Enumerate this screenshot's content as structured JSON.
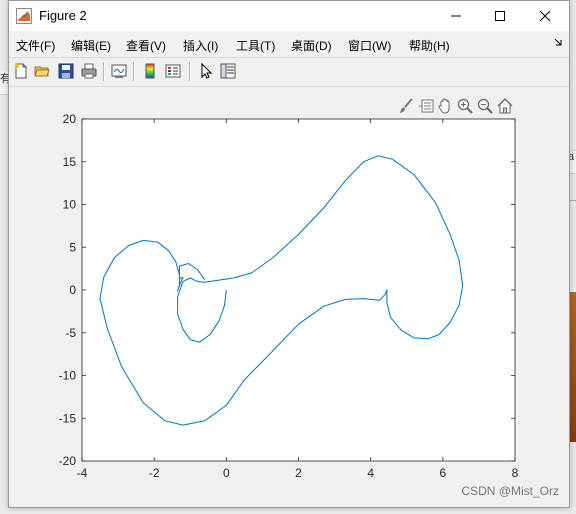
{
  "window": {
    "title": "Figure 2",
    "buttons": {
      "minimize": "—",
      "maximize": "☐",
      "close": "✕"
    }
  },
  "menu": {
    "items": [
      {
        "label": "文件(F)"
      },
      {
        "label": "编辑(E)"
      },
      {
        "label": "查看(V)"
      },
      {
        "label": "插入(I)"
      },
      {
        "label": "工具(T)"
      },
      {
        "label": "桌面(D)"
      },
      {
        "label": "窗口(W)"
      },
      {
        "label": "帮助(H)"
      }
    ],
    "overflow_icon": "menu-overflow-arrow"
  },
  "toolbar": {
    "icons": [
      "new-figure-icon",
      "open-file-icon",
      "save-icon",
      "print-icon",
      "link-icon",
      "colorbar-icon",
      "legend-icon",
      "pointer-icon",
      "property-editor-icon"
    ]
  },
  "axes_toolbar": {
    "icons": [
      "brush-icon",
      "data-tips-icon",
      "pan-icon",
      "zoom-in-icon",
      "zoom-out-icon",
      "home-icon"
    ]
  },
  "chart_data": {
    "type": "line",
    "title": "",
    "xlabel": "",
    "ylabel": "",
    "xlim": [
      -4,
      8
    ],
    "ylim": [
      -20,
      20
    ],
    "xticks": [
      -4,
      -2,
      0,
      2,
      4,
      6,
      8
    ],
    "yticks": [
      -20,
      -15,
      -10,
      -5,
      0,
      5,
      10,
      15,
      20
    ],
    "grid": false,
    "line_color": "#0072bd",
    "series": [
      {
        "name": "",
        "points": [
          [
            0.0,
            0.0
          ],
          [
            -0.05,
            -1.8
          ],
          [
            -0.2,
            -3.6
          ],
          [
            -0.45,
            -5.2
          ],
          [
            -0.75,
            -6.1
          ],
          [
            -1.0,
            -5.8
          ],
          [
            -1.2,
            -4.6
          ],
          [
            -1.35,
            -2.8
          ],
          [
            -1.35,
            -0.8
          ],
          [
            -1.2,
            1.0
          ],
          [
            -1.0,
            1.4
          ],
          [
            -0.8,
            1.0
          ],
          [
            -0.6,
            0.9
          ],
          [
            -0.3,
            1.1
          ],
          [
            0.2,
            1.4
          ],
          [
            0.7,
            2.0
          ],
          [
            1.3,
            3.8
          ],
          [
            2.0,
            6.5
          ],
          [
            2.7,
            9.6
          ],
          [
            3.3,
            12.8
          ],
          [
            3.8,
            15.0
          ],
          [
            4.2,
            15.7
          ],
          [
            4.6,
            15.3
          ],
          [
            5.2,
            13.5
          ],
          [
            5.8,
            10.2
          ],
          [
            6.2,
            6.5
          ],
          [
            6.45,
            3.5
          ],
          [
            6.55,
            0.5
          ],
          [
            6.45,
            -1.8
          ],
          [
            6.2,
            -3.8
          ],
          [
            5.9,
            -5.2
          ],
          [
            5.6,
            -5.7
          ],
          [
            5.2,
            -5.6
          ],
          [
            4.85,
            -4.7
          ],
          [
            4.55,
            -3.2
          ],
          [
            4.45,
            -1.5
          ],
          [
            4.45,
            0.0
          ],
          [
            4.4,
            -0.5
          ],
          [
            4.25,
            -1.2
          ],
          [
            3.8,
            -1.0
          ],
          [
            3.3,
            -1.1
          ],
          [
            2.7,
            -1.9
          ],
          [
            2.0,
            -4.0
          ],
          [
            1.2,
            -7.5
          ],
          [
            0.5,
            -10.5
          ],
          [
            0.0,
            -13.5
          ],
          [
            -0.6,
            -15.3
          ],
          [
            -1.2,
            -15.8
          ],
          [
            -1.7,
            -15.3
          ],
          [
            -2.3,
            -13.2
          ],
          [
            -2.9,
            -9.0
          ],
          [
            -3.3,
            -4.5
          ],
          [
            -3.5,
            -1.0
          ],
          [
            -3.4,
            1.5
          ],
          [
            -3.1,
            3.8
          ],
          [
            -2.7,
            5.2
          ],
          [
            -2.3,
            5.8
          ],
          [
            -1.9,
            5.6
          ],
          [
            -1.6,
            4.6
          ],
          [
            -1.4,
            3.3
          ],
          [
            -1.3,
            1.8
          ],
          [
            -1.3,
            0.6
          ],
          [
            -1.35,
            -0.1
          ],
          [
            -1.3,
            0.5
          ],
          [
            -1.2,
            1.5
          ],
          [
            -1.3,
            1.3
          ],
          [
            -1.3,
            2.8
          ],
          [
            -1.05,
            3.1
          ],
          [
            -0.8,
            2.4
          ],
          [
            -0.6,
            1.2
          ]
        ]
      }
    ]
  },
  "watermark": "CSDN @Mist_Orz"
}
